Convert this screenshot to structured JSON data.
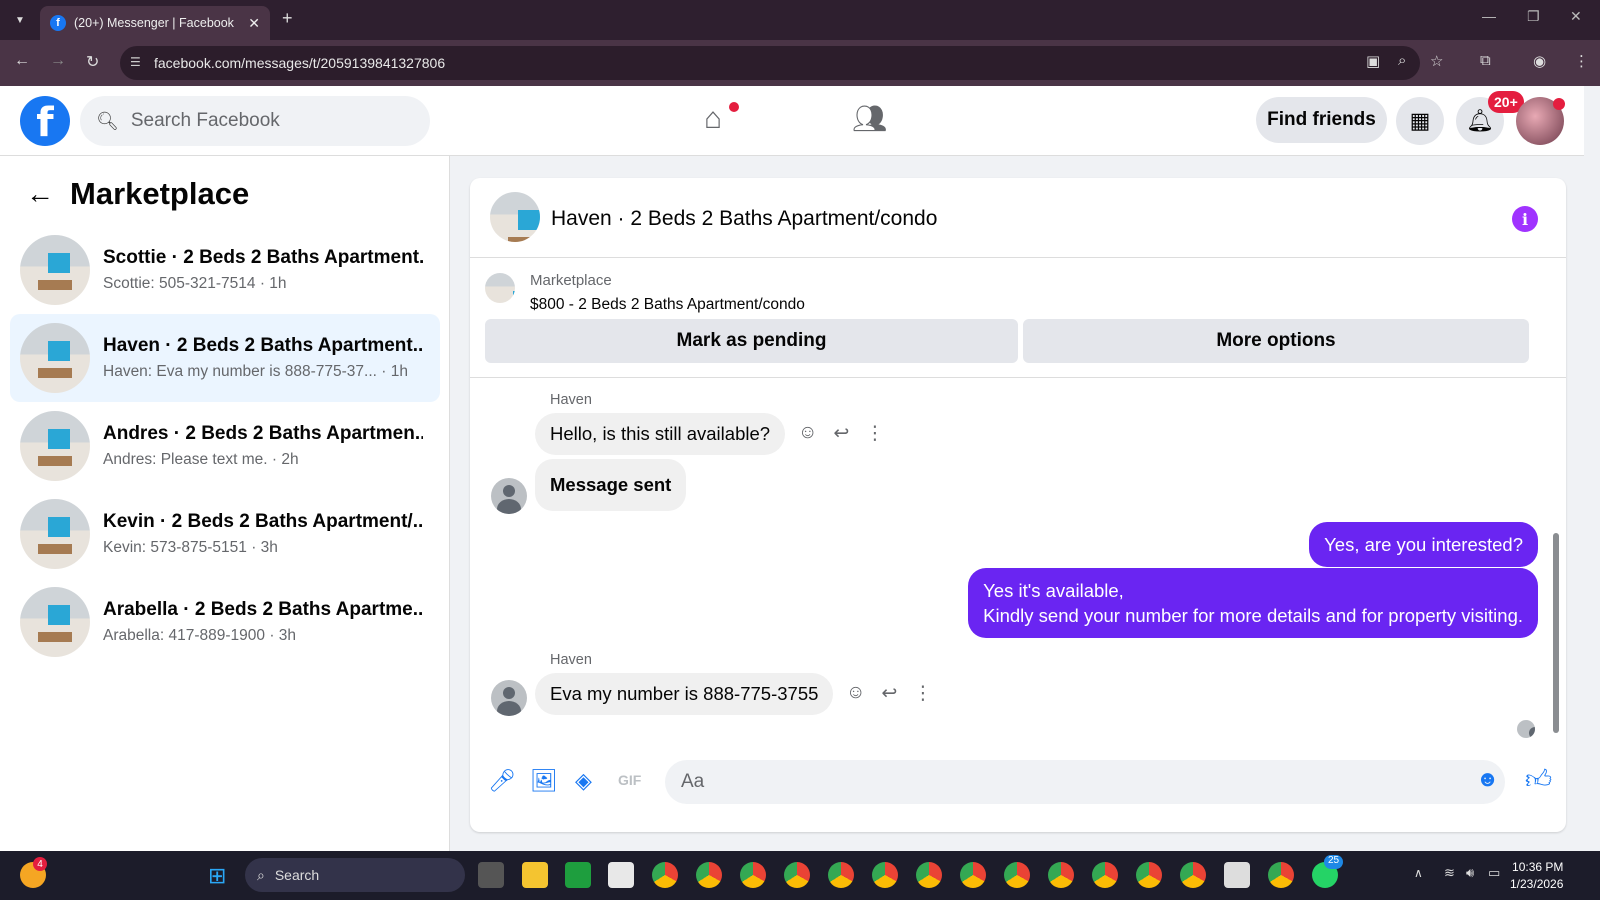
{
  "browser": {
    "tab_title": "(20+) Messenger | Facebook",
    "url": "facebook.com/messages/t/2059139841327806"
  },
  "header": {
    "search_placeholder": "Search Facebook",
    "find_friends": "Find friends",
    "notification_badge": "20+"
  },
  "sidebar": {
    "title": "Marketplace",
    "conversations": [
      {
        "name": "Scottie · 2 Beds 2 Baths Apartment...",
        "preview": "Scottie: 505-321-7514 · 1h",
        "active": false
      },
      {
        "name": "Haven · 2 Beds 2 Baths Apartment...",
        "preview": "Haven: Eva my number is 888-775-37... · 1h",
        "active": true
      },
      {
        "name": "Andres · 2 Beds 2 Baths Apartmen...",
        "preview": "Andres: Please text me. · 2h",
        "active": false
      },
      {
        "name": "Kevin · 2 Beds 2 Baths Apartment/...",
        "preview": "Kevin: 573-875-5151 · 3h",
        "active": false
      },
      {
        "name": "Arabella · 2 Beds 2 Baths Apartme...",
        "preview": "Arabella: 417-889-1900 · 3h",
        "active": false
      }
    ]
  },
  "chat": {
    "title": "Haven · 2 Beds 2 Baths Apartment/condo",
    "marketplace_label": "Marketplace",
    "listing": "$800 - 2 Beds 2 Baths Apartment/condo",
    "mark_pending": "Mark as pending",
    "more_options": "More options",
    "sender1": "Haven",
    "msg1": "Hello, is this still available?",
    "msg2": "Message sent",
    "msg3": "Yes, are you interested?",
    "msg4_line1": "Yes it's available,",
    "msg4_line2": "Kindly send your number for more details and for property visiting.",
    "sender2": "Haven",
    "msg5": "Eva my number is 888-775-3755",
    "composer_placeholder": "Aa"
  },
  "taskbar": {
    "search": "Search",
    "time": "10:36 PM",
    "date": "1/23/2026",
    "left_badge": "4",
    "whatsapp_badge": "25"
  },
  "colors": {
    "fb_blue": "#1877f2",
    "outgoing": "#6a25f2",
    "active_row": "#ebf5ff"
  }
}
